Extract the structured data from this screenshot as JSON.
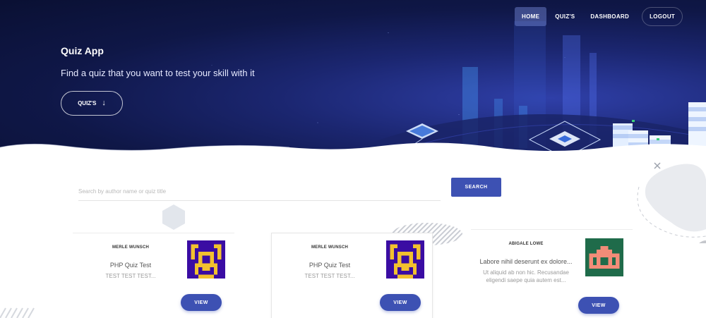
{
  "nav": {
    "items": [
      {
        "label": "HOME",
        "active": true
      },
      {
        "label": "QUIZ'S",
        "active": false
      },
      {
        "label": "DASHBOARD",
        "active": false
      },
      {
        "label": "LOGOUT",
        "active": false
      }
    ]
  },
  "hero": {
    "title": "Quiz App",
    "subtitle": "Find a quiz that you want to test your skill with it",
    "button_label": "QUIZ'S",
    "button_icon": "arrow-down-icon"
  },
  "search": {
    "placeholder": "Search by author name or quiz title",
    "value": "",
    "button_label": "SEARCH"
  },
  "cards": [
    {
      "author": "MERLE WUNSCH",
      "title": "PHP Quiz Test",
      "description": "TEST TEST TEST...",
      "view_label": "VIEW",
      "thumb_colors": [
        "#3a0ca3",
        "#f2c12e"
      ]
    },
    {
      "author": "MERLE WUNSCH",
      "title": "PHP Quiz Test",
      "description": "TEST TEST TEST...",
      "view_label": "VIEW",
      "thumb_colors": [
        "#3a0ca3",
        "#f2c12e"
      ]
    },
    {
      "author": "ABIGALE LOWE",
      "title": "Labore nihil deserunt ex dolore...",
      "description": "Ut aliquid ab non hic. Recusandae eligendi saepe quia autem est...",
      "view_label": "VIEW",
      "thumb_colors": [
        "#1f6b4a",
        "#f28c78"
      ]
    }
  ],
  "colors": {
    "accent": "#3d51b3",
    "hero_dark": "#0f1747"
  }
}
